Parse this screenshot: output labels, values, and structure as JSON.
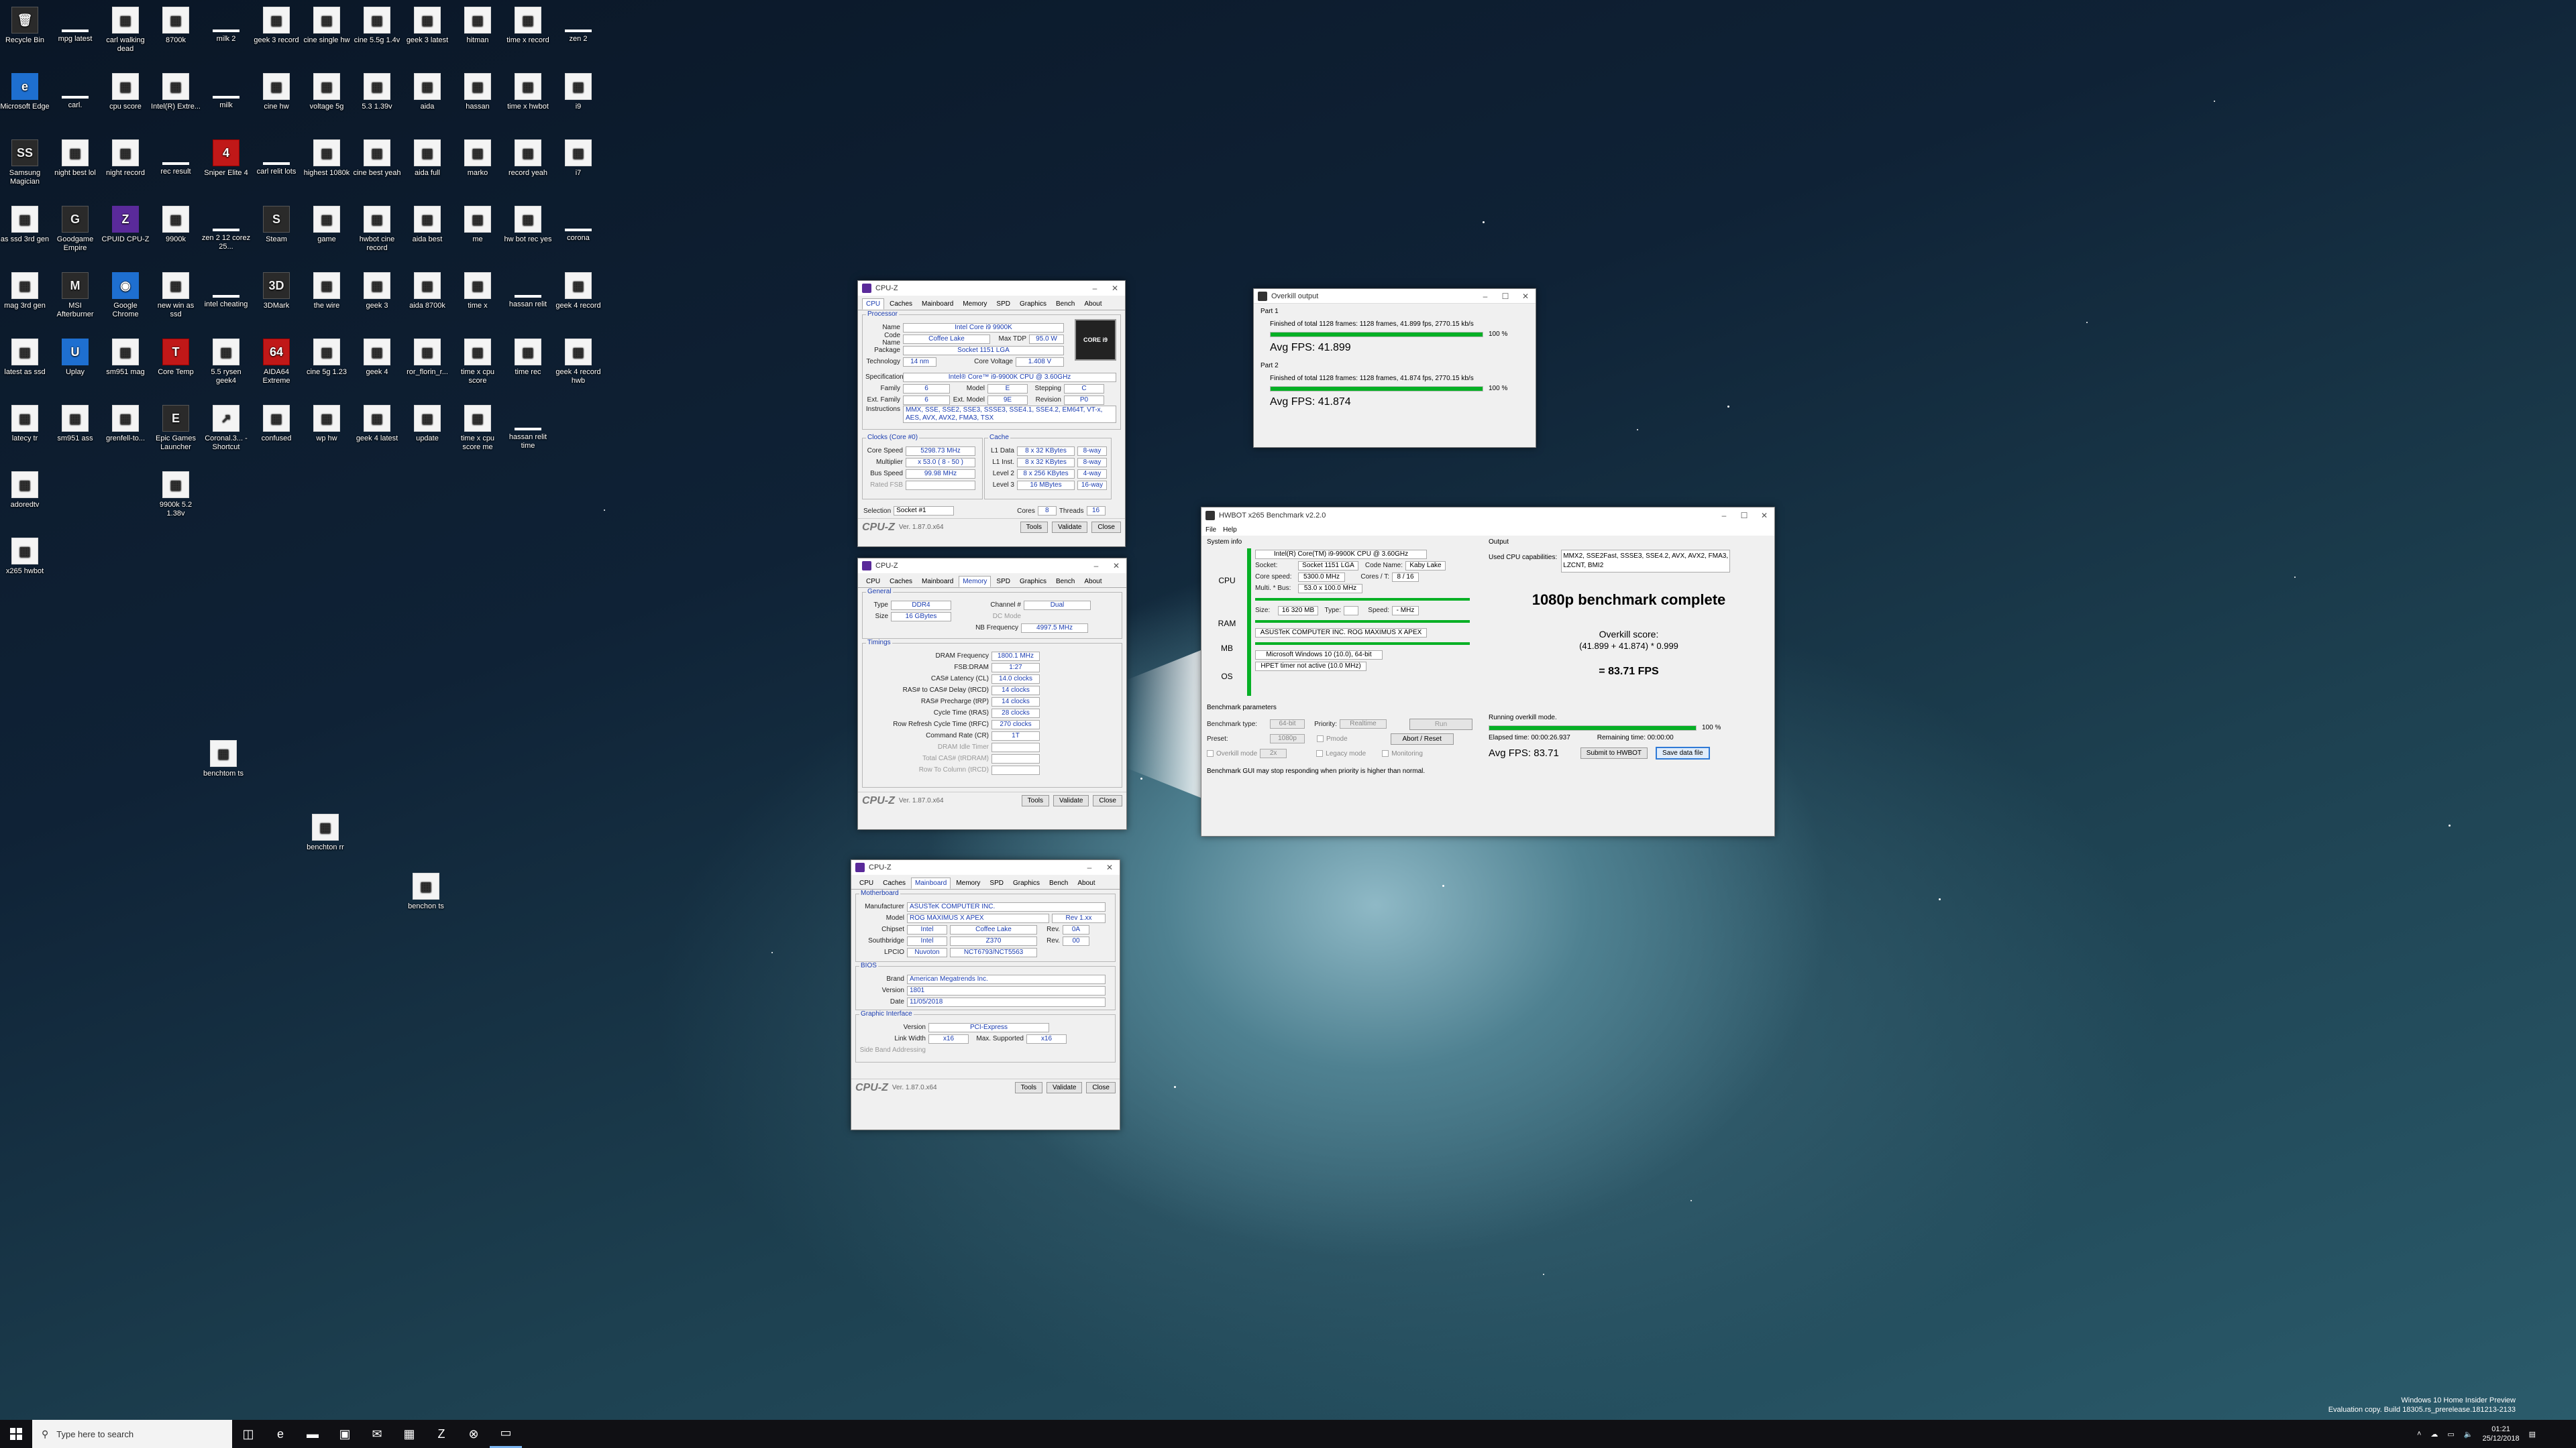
{
  "desktop": {
    "icons": [
      {
        "label": "Recycle Bin",
        "icon": "recycle-bin-icon",
        "col": 0,
        "row": 0
      },
      {
        "label": "mpg latest",
        "icon": "file-icon",
        "col": 1,
        "row": 0
      },
      {
        "label": "carl walking dead",
        "icon": "image-icon",
        "col": 2,
        "row": 0
      },
      {
        "label": "8700k",
        "icon": "image-icon",
        "col": 3,
        "row": 0
      },
      {
        "label": "milk 2",
        "icon": "file-icon",
        "col": 4,
        "row": 0
      },
      {
        "label": "geek 3 record",
        "icon": "image-icon",
        "col": 5,
        "row": 0
      },
      {
        "label": "cine single hw",
        "icon": "image-icon",
        "col": 6,
        "row": 0
      },
      {
        "label": "cine 5.5g 1.4v",
        "icon": "image-icon",
        "col": 7,
        "row": 0
      },
      {
        "label": "geek 3 latest",
        "icon": "image-icon",
        "col": 8,
        "row": 0
      },
      {
        "label": "hitman",
        "icon": "image-icon",
        "col": 9,
        "row": 0
      },
      {
        "label": "time x record",
        "icon": "image-icon",
        "col": 10,
        "row": 0
      },
      {
        "label": "zen 2",
        "icon": "file-icon",
        "col": 11,
        "row": 0
      },
      {
        "label": "Microsoft Edge",
        "icon": "edge-icon",
        "col": 0,
        "row": 1
      },
      {
        "label": "carl.",
        "icon": "file-icon",
        "col": 1,
        "row": 1
      },
      {
        "label": "cpu score",
        "icon": "image-icon",
        "col": 2,
        "row": 1
      },
      {
        "label": "Intel(R) Extre...",
        "icon": "image-icon",
        "col": 3,
        "row": 1
      },
      {
        "label": "milk",
        "icon": "file-icon",
        "col": 4,
        "row": 1
      },
      {
        "label": "cine hw",
        "icon": "image-icon",
        "col": 5,
        "row": 1
      },
      {
        "label": "voltage 5g",
        "icon": "image-icon",
        "col": 6,
        "row": 1
      },
      {
        "label": "5.3 1.39v",
        "icon": "image-icon",
        "col": 7,
        "row": 1
      },
      {
        "label": "aida",
        "icon": "image-icon",
        "col": 8,
        "row": 1
      },
      {
        "label": "hassan",
        "icon": "image-icon",
        "col": 9,
        "row": 1
      },
      {
        "label": "time x hwbot",
        "icon": "image-icon",
        "col": 10,
        "row": 1
      },
      {
        "label": "i9",
        "icon": "image-icon",
        "col": 11,
        "row": 1
      },
      {
        "label": "Samsung Magician",
        "icon": "samsung-magician-icon",
        "col": 0,
        "row": 2
      },
      {
        "label": "night best lol",
        "icon": "image-icon",
        "col": 1,
        "row": 2
      },
      {
        "label": "night record",
        "icon": "image-icon",
        "col": 2,
        "row": 2
      },
      {
        "label": "rec result",
        "icon": "file-icon",
        "col": 3,
        "row": 2
      },
      {
        "label": "Sniper Elite 4",
        "icon": "sniper-elite-icon",
        "col": 4,
        "row": 2
      },
      {
        "label": "carl relit lots",
        "icon": "file-icon",
        "col": 5,
        "row": 2
      },
      {
        "label": "highest 1080k",
        "icon": "image-icon",
        "col": 6,
        "row": 2
      },
      {
        "label": "cine best yeah",
        "icon": "image-icon",
        "col": 7,
        "row": 2
      },
      {
        "label": "aida full",
        "icon": "image-icon",
        "col": 8,
        "row": 2
      },
      {
        "label": "marko",
        "icon": "image-icon",
        "col": 9,
        "row": 2
      },
      {
        "label": "record yeah",
        "icon": "image-icon",
        "col": 10,
        "row": 2
      },
      {
        "label": "i7",
        "icon": "image-icon",
        "col": 11,
        "row": 2
      },
      {
        "label": "as ssd 3rd gen",
        "icon": "image-icon",
        "col": 0,
        "row": 3
      },
      {
        "label": "Goodgame Empire",
        "icon": "goodgame-icon",
        "col": 1,
        "row": 3
      },
      {
        "label": "CPUID CPU-Z",
        "icon": "cpuz-icon",
        "col": 2,
        "row": 3
      },
      {
        "label": "9900k",
        "icon": "image-icon",
        "col": 3,
        "row": 3
      },
      {
        "label": "zen 2 12 corez 25...",
        "icon": "file-icon",
        "col": 4,
        "row": 3
      },
      {
        "label": "Steam",
        "icon": "steam-icon",
        "col": 5,
        "row": 3
      },
      {
        "label": "game",
        "icon": "image-icon",
        "col": 6,
        "row": 3
      },
      {
        "label": "hwbot cine record",
        "icon": "image-icon",
        "col": 7,
        "row": 3
      },
      {
        "label": "aida best",
        "icon": "image-icon",
        "col": 8,
        "row": 3
      },
      {
        "label": "me",
        "icon": "image-icon",
        "col": 9,
        "row": 3
      },
      {
        "label": "hw bot rec yes",
        "icon": "image-icon",
        "col": 10,
        "row": 3
      },
      {
        "label": "corona",
        "icon": "file-icon",
        "col": 11,
        "row": 3
      },
      {
        "label": "mag 3rd gen",
        "icon": "image-icon",
        "col": 0,
        "row": 4
      },
      {
        "label": "MSI Afterburner",
        "icon": "msi-afterburner-icon",
        "col": 1,
        "row": 4
      },
      {
        "label": "Google Chrome",
        "icon": "chrome-icon",
        "col": 2,
        "row": 4
      },
      {
        "label": "new win as ssd",
        "icon": "image-icon",
        "col": 3,
        "row": 4
      },
      {
        "label": "intel cheating",
        "icon": "file-icon",
        "col": 4,
        "row": 4
      },
      {
        "label": "3DMark",
        "icon": "3dmark-icon",
        "col": 5,
        "row": 4
      },
      {
        "label": "the wire",
        "icon": "image-icon",
        "col": 6,
        "row": 4
      },
      {
        "label": "geek 3",
        "icon": "image-icon",
        "col": 7,
        "row": 4
      },
      {
        "label": "aida 8700k",
        "icon": "image-icon",
        "col": 8,
        "row": 4
      },
      {
        "label": "time x",
        "icon": "image-icon",
        "col": 9,
        "row": 4
      },
      {
        "label": "hassan relit",
        "icon": "file-icon",
        "col": 10,
        "row": 4
      },
      {
        "label": "geek 4 record",
        "icon": "image-icon",
        "col": 11,
        "row": 4
      },
      {
        "label": "latest as ssd",
        "icon": "image-icon",
        "col": 0,
        "row": 5
      },
      {
        "label": "Uplay",
        "icon": "uplay-icon",
        "col": 1,
        "row": 5
      },
      {
        "label": "sm951 mag",
        "icon": "image-icon",
        "col": 2,
        "row": 5
      },
      {
        "label": "Core Temp",
        "icon": "core-temp-icon",
        "col": 3,
        "row": 5
      },
      {
        "label": "5.5 rysen geek4",
        "icon": "image-icon",
        "col": 4,
        "row": 5
      },
      {
        "label": "AIDA64 Extreme",
        "icon": "aida64-icon",
        "col": 5,
        "row": 5
      },
      {
        "label": "cine 5g 1.23",
        "icon": "image-icon",
        "col": 6,
        "row": 5
      },
      {
        "label": "geek 4",
        "icon": "image-icon",
        "col": 7,
        "row": 5
      },
      {
        "label": "ror_florin_r...",
        "icon": "image-icon",
        "col": 8,
        "row": 5
      },
      {
        "label": "time x cpu score",
        "icon": "image-icon",
        "col": 9,
        "row": 5
      },
      {
        "label": "time rec",
        "icon": "image-icon",
        "col": 10,
        "row": 5
      },
      {
        "label": "geek 4 record hwb",
        "icon": "image-icon",
        "col": 11,
        "row": 5
      },
      {
        "label": "latecy tr",
        "icon": "image-icon",
        "col": 0,
        "row": 6
      },
      {
        "label": "sm951 ass",
        "icon": "image-icon",
        "col": 1,
        "row": 6
      },
      {
        "label": "grenfell-to...",
        "icon": "image-icon",
        "col": 2,
        "row": 6
      },
      {
        "label": "Epic Games Launcher",
        "icon": "epic-games-icon",
        "col": 3,
        "row": 6
      },
      {
        "label": "Coronal.3... - Shortcut",
        "icon": "shortcut-icon",
        "col": 4,
        "row": 6
      },
      {
        "label": "confused",
        "icon": "image-icon",
        "col": 5,
        "row": 6
      },
      {
        "label": "wp hw",
        "icon": "image-icon",
        "col": 6,
        "row": 6
      },
      {
        "label": "geek 4 latest",
        "icon": "image-icon",
        "col": 7,
        "row": 6
      },
      {
        "label": "update",
        "icon": "image-icon",
        "col": 8,
        "row": 6
      },
      {
        "label": "time x cpu score me",
        "icon": "image-icon",
        "col": 9,
        "row": 6
      },
      {
        "label": "hassan relit time",
        "icon": "file-icon",
        "col": 10,
        "row": 6
      },
      {
        "label": "adoredtv",
        "icon": "image-icon",
        "col": 0,
        "row": 7
      },
      {
        "label": "9900k 5.2 1.38v",
        "icon": "image-icon",
        "col": 3,
        "row": 7
      },
      {
        "label": "x265 hwbot",
        "icon": "image-icon",
        "col": 0,
        "row": 8
      }
    ],
    "loose_icons": [
      {
        "label": "benchtom ts",
        "icon": "image-icon"
      },
      {
        "label": "benchton rr",
        "icon": "image-icon"
      },
      {
        "label": "benchon ts",
        "icon": "image-icon"
      }
    ]
  },
  "cpuz1": {
    "title": "CPU-Z",
    "tabs": [
      "CPU",
      "Caches",
      "Mainboard",
      "Memory",
      "SPD",
      "Graphics",
      "Bench",
      "About"
    ],
    "active_tab": "CPU",
    "processor_label": "Processor",
    "name_label": "Name",
    "name": "Intel Core i9 9900K",
    "codename_label": "Code Name",
    "codename": "Coffee Lake",
    "maxtdp_label": "Max TDP",
    "maxtdp": "95.0 W",
    "package_label": "Package",
    "package": "Socket 1151 LGA",
    "technology_label": "Technology",
    "technology": "14 nm",
    "corevoltage_label": "Core Voltage",
    "corevoltage": "1.408 V",
    "spec_label": "Specification",
    "spec": "Intel® Core™ i9-9900K CPU @ 3.60GHz",
    "family_label": "Family",
    "family": "6",
    "model_label": "Model",
    "model": "E",
    "stepping_label": "Stepping",
    "stepping": "C",
    "extfamily_label": "Ext. Family",
    "extfamily": "6",
    "extmodel_label": "Ext. Model",
    "extmodel": "9E",
    "revision_label": "Revision",
    "revision": "P0",
    "instr_label": "Instructions",
    "instr": "MMX, SSE, SSE2, SSE3, SSSE3, SSE4.1, SSE4.2, EM64T, VT-x, AES, AVX, AVX2, FMA3, TSX",
    "clocks_label": "Clocks (Core #0)",
    "corespeed_label": "Core Speed",
    "corespeed": "5298.73 MHz",
    "multiplier_label": "Multiplier",
    "multiplier": "x 53.0 ( 8 - 50 )",
    "busspeed_label": "Bus Speed",
    "busspeed": "99.98 MHz",
    "ratedfsb_label": "Rated FSB",
    "cache_label": "Cache",
    "l1d_label": "L1 Data",
    "l1d": "8 x 32 KBytes",
    "l1d_way": "8-way",
    "l1i_label": "L1 Inst.",
    "l1i": "8 x 32 KBytes",
    "l1i_way": "8-way",
    "l2_label": "Level 2",
    "l2": "8 x 256 KBytes",
    "l2_way": "4-way",
    "l3_label": "Level 3",
    "l3": "16 MBytes",
    "l3_way": "16-way",
    "selection_label": "Selection",
    "selection": "Socket #1",
    "cores_label": "Cores",
    "cores": "8",
    "threads_label": "Threads",
    "threads": "16",
    "logo_text": "CORE i9",
    "version": "Ver. 1.87.0.x64",
    "tools": "Tools",
    "validate": "Validate",
    "close": "Close"
  },
  "cpuz2": {
    "title": "CPU-Z",
    "tabs": [
      "CPU",
      "Caches",
      "Mainboard",
      "Memory",
      "SPD",
      "Graphics",
      "Bench",
      "About"
    ],
    "active_tab": "Memory",
    "general_label": "General",
    "type_label": "Type",
    "type": "DDR4",
    "channel_label": "Channel #",
    "channel": "Dual",
    "size_label": "Size",
    "size": "16 GBytes",
    "dcmode_label": "DC Mode",
    "nbfreq_label": "NB Frequency",
    "nbfreq": "4997.5 MHz",
    "timings_label": "Timings",
    "timings": [
      {
        "label": "DRAM Frequency",
        "value": "1800.1 MHz"
      },
      {
        "label": "FSB:DRAM",
        "value": "1:27"
      },
      {
        "label": "CAS# Latency (CL)",
        "value": "14.0 clocks"
      },
      {
        "label": "RAS# to CAS# Delay (tRCD)",
        "value": "14 clocks"
      },
      {
        "label": "RAS# Precharge (tRP)",
        "value": "14 clocks"
      },
      {
        "label": "Cycle Time (tRAS)",
        "value": "28 clocks"
      },
      {
        "label": "Row Refresh Cycle Time (tRFC)",
        "value": "270 clocks"
      },
      {
        "label": "Command Rate (CR)",
        "value": "1T"
      },
      {
        "label": "DRAM Idle Timer",
        "value": ""
      },
      {
        "label": "Total CAS# (tRDRAM)",
        "value": ""
      },
      {
        "label": "Row To Column (tRCD)",
        "value": ""
      }
    ],
    "version": "Ver. 1.87.0.x64",
    "tools": "Tools",
    "validate": "Validate",
    "close": "Close"
  },
  "cpuz3": {
    "title": "CPU-Z",
    "tabs": [
      "CPU",
      "Caches",
      "Mainboard",
      "Memory",
      "SPD",
      "Graphics",
      "Bench",
      "About"
    ],
    "active_tab": "Mainboard",
    "motherboard_label": "Motherboard",
    "manufacturer_label": "Manufacturer",
    "manufacturer": "ASUSTeK COMPUTER INC.",
    "model_label": "Model",
    "model": "ROG MAXIMUS X APEX",
    "model_rev": "Rev 1.xx",
    "chipset_label": "Chipset",
    "chipset_vendor": "Intel",
    "chipset": "Coffee Lake",
    "chipset_rev_label": "Rev.",
    "chipset_rev": "0A",
    "southbridge_label": "Southbridge",
    "southbridge_vendor": "Intel",
    "southbridge": "Z370",
    "southbridge_rev_label": "Rev.",
    "southbridge_rev": "00",
    "lpcio_label": "LPCIO",
    "lpcio_vendor": "Nuvoton",
    "lpcio": "NCT6793/NCT5563",
    "bios_label": "BIOS",
    "brand_label": "Brand",
    "brand": "American Megatrends Inc.",
    "bversion_label": "Version",
    "bversion": "1801",
    "date_label": "Date",
    "date": "11/05/2018",
    "gi_label": "Graphic Interface",
    "giversion_label": "Version",
    "giversion": "PCI-Express",
    "linkwidth_label": "Link Width",
    "linkwidth": "x16",
    "maxsup_label": "Max. Supported",
    "maxsup": "x16",
    "sideband_label": "Side Band Addressing",
    "version": "Ver. 1.87.0.x64",
    "tools": "Tools",
    "validate": "Validate",
    "close": "Close"
  },
  "overkill": {
    "title": "Overkill output",
    "part1_label": "Part 1",
    "part1_text": "Finished of total 1128 frames: 1128 frames, 41.899 fps,  2770.15 kb/s",
    "part1_pct": "100 %",
    "part1_fill": 1.0,
    "part1_avg": "Avg FPS: 41.899",
    "part2_label": "Part 2",
    "part2_text": "Finished of total 1128 frames: 1128 frames, 41.874 fps,  2770.15 kb/s",
    "part2_pct": "100 %",
    "part2_fill": 1.0,
    "part2_avg": "Avg FPS: 41.874"
  },
  "hwbot": {
    "title": "HWBOT x265 Benchmark v2.2.0",
    "menu": [
      "File",
      "Help"
    ],
    "sysinfo_label": "System info",
    "output_label": "Output",
    "cpu_label": "CPU",
    "ram_label": "RAM",
    "mb_label": "MB",
    "os_label": "OS",
    "cpu_name": "Intel(R) Core(TM) i9-9900K CPU @ 3.60GHz",
    "socket_label": "Socket:",
    "socket": "Socket 1151 LGA",
    "codename_label": "Code Name:",
    "codename": "Kaby Lake",
    "corespeed_label": "Core speed:",
    "corespeed": "5300.0 MHz",
    "coresthreads_label": "Cores / T:",
    "coresthreads": "8 / 16",
    "multbus_label": "Multi. * Bus:",
    "multbus": "53.0 x 100.0 MHz",
    "ramsize_label": "Size:",
    "ramsize": "16 320 MB",
    "ramtype_label": "Type:",
    "ramtype": "",
    "ramspeed_label": "Speed:",
    "ramspeed": "- MHz",
    "mb": "ASUSTeK COMPUTER INC. ROG MAXIMUS X APEX",
    "os": "Microsoft Windows 10 (10.0), 64-bit",
    "hpet": "HPET timer not active (10.0 MHz)",
    "used_cpu_label": "Used CPU capabilities:",
    "used_cpu": "MMX2, SSE2Fast, SSSE3, SSE4.2, AVX, AVX2, FMA3, LZCNT, BMI2",
    "complete": "1080p benchmark complete",
    "score_label": "Overkill score:",
    "score_formula": "(41.899 + 41.874) * 0.999",
    "score_result": "= 83.71 FPS",
    "bp_label": "Benchmark parameters",
    "btype_label": "Benchmark type:",
    "btype": "64-bit",
    "priority_label": "Priority:",
    "priority": "Realtime",
    "run_btn": "Run",
    "preset_label": "Preset:",
    "preset": "1080p",
    "pmode_label": "Pmode",
    "abort_btn": "Abort / Reset",
    "overkill_mode_label": "Overkill mode",
    "overkill_mode": "2x",
    "legacy_label": "Legacy mode",
    "monitoring_label": "Monitoring",
    "running_text": "Running overkill mode.",
    "progress_pct": "100 %",
    "progress_fill": 1.0,
    "elapsed": "Elapsed time: 00:00:26.937",
    "remaining": "Remaining time: 00:00:00",
    "avg_fps": "Avg FPS: 83.71",
    "submit_btn": "Submit to HWBOT",
    "save_btn": "Save data file",
    "warning": "Benchmark GUI may stop responding when priority is higher than normal."
  },
  "taskbar": {
    "search_placeholder": "Type here to search",
    "time": "01:21",
    "date": "25/12/2018",
    "icons": [
      "task-view-icon",
      "edge-icon",
      "file-explorer-icon",
      "store-icon",
      "mail-icon",
      "spreadsheet-icon",
      "cpuz-icon",
      "xbox-icon",
      "hwbot-icon"
    ]
  },
  "watermark": {
    "line1": "Windows 10 Home Insider Preview",
    "line2": "Evaluation copy. Build 18305.rs_prerelease.181213-2133"
  }
}
